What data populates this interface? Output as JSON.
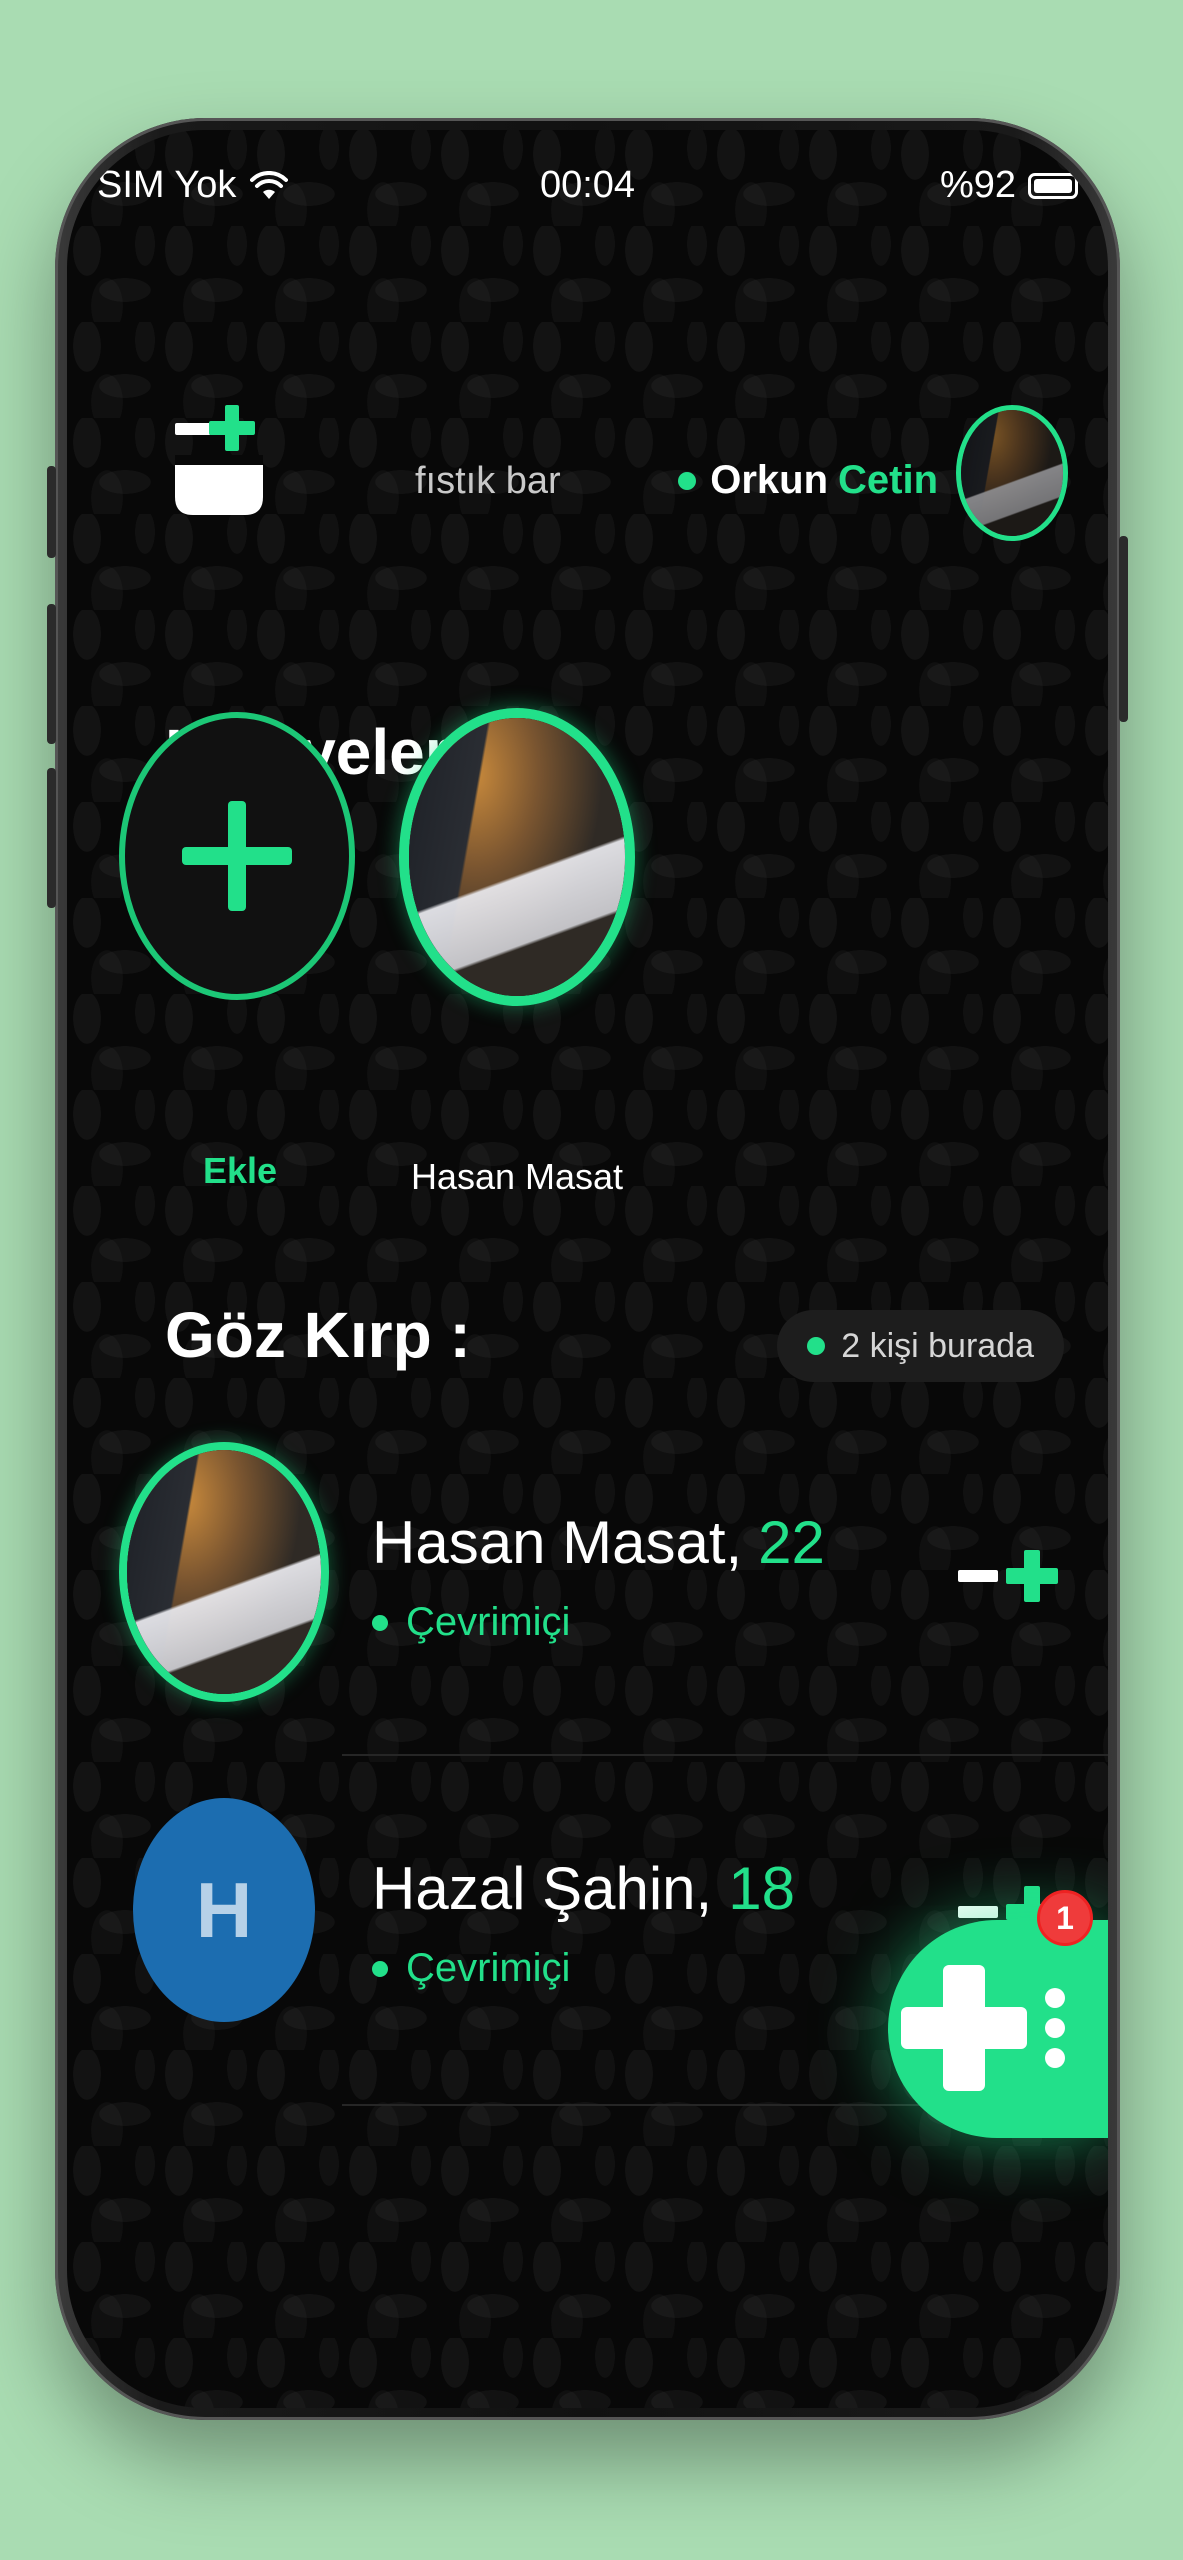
{
  "status_bar": {
    "carrier": "SIM Yok",
    "time": "00:04",
    "battery": "%92"
  },
  "header": {
    "app_name": "fıstık bar",
    "user_first": "Orkun",
    "user_last": "Cetin"
  },
  "stories": {
    "title": "Hikayeler:",
    "add_label": "Ekle",
    "items": [
      {
        "name": "Hasan Masat"
      }
    ]
  },
  "nearby": {
    "title": "Göz Kırp :",
    "count_label": "2 kişi burada",
    "users": [
      {
        "name": "Hasan Masat,",
        "age": "22",
        "status": "Çevrimiçi"
      },
      {
        "name": "Hazal Şahin,",
        "age": "18",
        "status": "Çevrimiçi",
        "initial": "H"
      }
    ]
  },
  "fab": {
    "badge": "1"
  },
  "colors": {
    "accent": "#22e08a",
    "background": "#a9dcb2",
    "avatar_blue": "#1c6db0",
    "badge_red": "#ef3b3b"
  }
}
